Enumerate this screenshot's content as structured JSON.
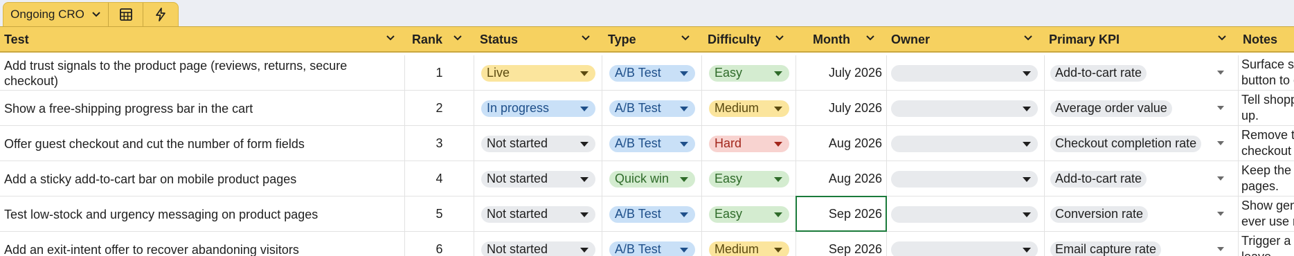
{
  "sheet_tab": {
    "name": "Ongoing CRO",
    "icons": [
      "calculator-icon",
      "lightning-icon"
    ]
  },
  "columns": [
    {
      "key": "test",
      "label": "Test"
    },
    {
      "key": "rank",
      "label": "Rank"
    },
    {
      "key": "status",
      "label": "Status"
    },
    {
      "key": "type",
      "label": "Type"
    },
    {
      "key": "difficulty",
      "label": "Difficulty"
    },
    {
      "key": "month",
      "label": "Month"
    },
    {
      "key": "owner",
      "label": "Owner"
    },
    {
      "key": "kpi",
      "label": "Primary KPI"
    },
    {
      "key": "notes",
      "label": "Notes"
    }
  ],
  "rows": [
    {
      "test": "Add trust signals to the product page (reviews, returns, secure checkout)",
      "rank": "1",
      "status": "Live",
      "type": "A/B Test",
      "difficulty": "Easy",
      "month": "July 2026",
      "owner": "",
      "kpi": "Add-to-cart rate",
      "notes": [
        "Surface sta",
        "button to c"
      ]
    },
    {
      "test": "Show a free-shipping progress bar in the cart",
      "rank": "2",
      "status": "In progress",
      "type": "A/B Test",
      "difficulty": "Medium",
      "month": "July 2026",
      "owner": "",
      "kpi": "Average order value",
      "notes": [
        "Tell shoppe",
        "up."
      ]
    },
    {
      "test": "Offer guest checkout and cut the number of form fields",
      "rank": "3",
      "status": "Not started",
      "type": "A/B Test",
      "difficulty": "Hard",
      "month": "Aug 2026",
      "owner": "",
      "kpi": "Checkout completion rate",
      "notes": [
        "Remove th",
        "checkout c"
      ]
    },
    {
      "test": "Add a sticky add-to-cart bar on mobile product pages",
      "rank": "4",
      "status": "Not started",
      "type": "Quick win",
      "difficulty": "Easy",
      "month": "Aug 2026",
      "owner": "",
      "kpi": "Add-to-cart rate",
      "notes": [
        "Keep the b",
        "pages."
      ]
    },
    {
      "test": "Test low-stock and urgency messaging on product pages",
      "rank": "5",
      "status": "Not started",
      "type": "A/B Test",
      "difficulty": "Easy",
      "month": "Sep 2026",
      "owner": "",
      "kpi": "Conversion rate",
      "notes": [
        "Show genu",
        "ever use re"
      ]
    },
    {
      "test": "Add an exit-intent offer to recover abandoning visitors",
      "rank": "6",
      "status": "Not started",
      "type": "A/B Test",
      "difficulty": "Medium",
      "month": "Sep 2026",
      "owner": "",
      "kpi": "Email capture rate",
      "notes": [
        "Trigger a fi",
        "leave."
      ]
    }
  ],
  "chip_colors": {
    "Live": {
      "bg": "#fbe59d",
      "fg": "#5b4a10"
    },
    "In progress": {
      "bg": "#c9e0f7",
      "fg": "#1e4f8a"
    },
    "Not started": {
      "bg": "#e8eaed",
      "fg": "#1f1f1f"
    },
    "A/B Test": {
      "bg": "#c9e0f7",
      "fg": "#1e4f8a"
    },
    "Quick win": {
      "bg": "#d4ecd0",
      "fg": "#2f6b2a"
    },
    "Easy": {
      "bg": "#d4ecd0",
      "fg": "#2f6b2a"
    },
    "Medium": {
      "bg": "#fbe59d",
      "fg": "#5b4a10"
    },
    "Hard": {
      "bg": "#f8d3d0",
      "fg": "#a3271c"
    }
  },
  "selected_cell": "row 5, Month"
}
